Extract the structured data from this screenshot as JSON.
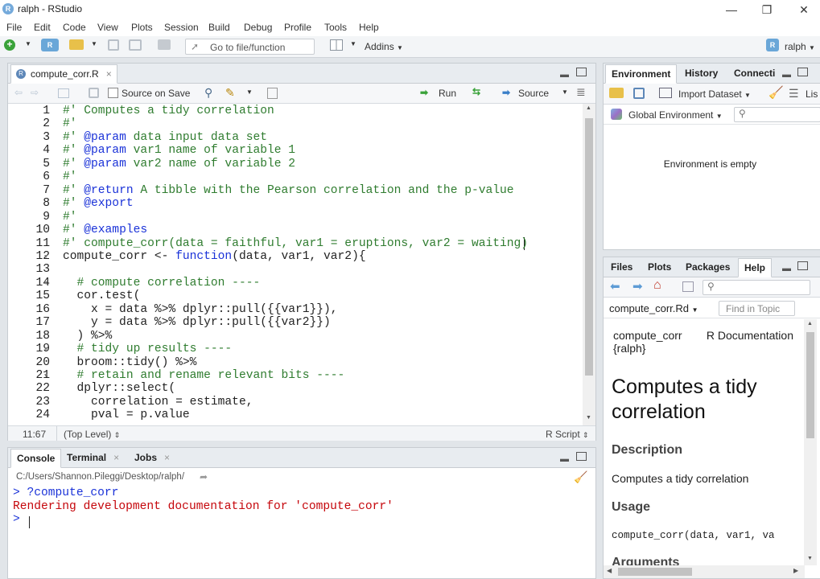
{
  "window": {
    "title": "ralph - RStudio",
    "minimize": "—",
    "maximize": "❐",
    "close": "✕"
  },
  "menu": [
    "File",
    "Edit",
    "Code",
    "View",
    "Plots",
    "Session",
    "Build",
    "Debug",
    "Profile",
    "Tools",
    "Help"
  ],
  "toolbar": {
    "goto_placeholder": "Go to file/function",
    "addins": "Addins",
    "project": "ralph"
  },
  "editor": {
    "tab_label": "compute_corr.R",
    "source_on_save": "Source on Save",
    "run": "Run",
    "source": "Source",
    "lines": [
      {
        "n": "1",
        "segs": [
          [
            "cmt",
            "#' Computes a tidy correlation"
          ]
        ]
      },
      {
        "n": "2",
        "segs": [
          [
            "cmt",
            "#'"
          ]
        ]
      },
      {
        "n": "3",
        "segs": [
          [
            "cmt",
            "#' "
          ],
          [
            "kw",
            "@param"
          ],
          [
            "cmt",
            " data input data set"
          ]
        ]
      },
      {
        "n": "4",
        "segs": [
          [
            "cmt",
            "#' "
          ],
          [
            "kw",
            "@param"
          ],
          [
            "cmt",
            " var1 name of variable 1"
          ]
        ]
      },
      {
        "n": "5",
        "segs": [
          [
            "cmt",
            "#' "
          ],
          [
            "kw",
            "@param"
          ],
          [
            "cmt",
            " var2 name of variable 2"
          ]
        ]
      },
      {
        "n": "6",
        "segs": [
          [
            "cmt",
            "#'"
          ]
        ]
      },
      {
        "n": "7",
        "segs": [
          [
            "cmt",
            "#' "
          ],
          [
            "kw",
            "@return"
          ],
          [
            "cmt",
            " A tibble with the Pearson correlation and the p-value"
          ]
        ]
      },
      {
        "n": "8",
        "segs": [
          [
            "cmt",
            "#' "
          ],
          [
            "kw",
            "@export"
          ]
        ]
      },
      {
        "n": "9",
        "segs": [
          [
            "cmt",
            "#'"
          ]
        ]
      },
      {
        "n": "10",
        "segs": [
          [
            "cmt",
            "#' "
          ],
          [
            "kw",
            "@examples"
          ]
        ]
      },
      {
        "n": "11",
        "segs": [
          [
            "cmt",
            "#' compute_corr(data = faithful, var1 = eruptions, var2 = waiting)"
          ]
        ]
      },
      {
        "n": "12",
        "fold": true,
        "segs": [
          [
            "",
            "compute_corr <- "
          ],
          [
            "kw",
            "function"
          ],
          [
            "",
            "(data, var1, var2){"
          ]
        ]
      },
      {
        "n": "13",
        "segs": []
      },
      {
        "n": "14",
        "fold": true,
        "segs": [
          [
            "",
            "  "
          ],
          [
            "cmt",
            "# compute correlation ----"
          ]
        ]
      },
      {
        "n": "15",
        "segs": [
          [
            "",
            "  cor.test("
          ]
        ]
      },
      {
        "n": "16",
        "segs": [
          [
            "",
            "    x = data %>% dplyr::pull({{var1}}),"
          ]
        ]
      },
      {
        "n": "17",
        "segs": [
          [
            "",
            "    y = data %>% dplyr::pull({{var2}})"
          ]
        ]
      },
      {
        "n": "18",
        "segs": [
          [
            "",
            "  ) %>%"
          ]
        ]
      },
      {
        "n": "19",
        "fold": true,
        "segs": [
          [
            "",
            "  "
          ],
          [
            "cmt",
            "# tidy up results ----"
          ]
        ]
      },
      {
        "n": "20",
        "segs": [
          [
            "",
            "  broom::tidy() %>%"
          ]
        ]
      },
      {
        "n": "21",
        "fold": true,
        "segs": [
          [
            "",
            "  "
          ],
          [
            "cmt",
            "# retain and rename relevant bits ----"
          ]
        ]
      },
      {
        "n": "22",
        "segs": [
          [
            "",
            "  dplyr::select("
          ]
        ]
      },
      {
        "n": "23",
        "segs": [
          [
            "",
            "    correlation = estimate,"
          ]
        ]
      },
      {
        "n": "24",
        "segs": [
          [
            "",
            "    pval = p.value"
          ]
        ]
      }
    ],
    "status": {
      "position": "11:67",
      "scope": "(Top Level)",
      "filetype": "R Script"
    }
  },
  "console": {
    "tabs": [
      "Console",
      "Terminal",
      "Jobs"
    ],
    "path": "C:/Users/Shannon.Pileggi/Desktop/ralph/",
    "lines": [
      {
        "cls": "cmd",
        "text": "> ?compute_corr"
      },
      {
        "cls": "err",
        "text": "Rendering development documentation for 'compute_corr'"
      },
      {
        "cls": "cmd",
        "text": ">"
      }
    ]
  },
  "environment": {
    "tabs": [
      "Environment",
      "History",
      "Connecti"
    ],
    "import_dataset": "Import Dataset",
    "list_label": "Lis",
    "scope": "Global Environment",
    "empty_message": "Environment is empty"
  },
  "help": {
    "tabs": [
      "Files",
      "Plots",
      "Packages",
      "Help"
    ],
    "topic": "compute_corr.Rd",
    "find_placeholder": "Find in Topic",
    "header_left": "compute_corr {ralph}",
    "header_right": "R Documentation",
    "title": "Computes a tidy correlation",
    "description_heading": "Description",
    "description": "Computes a tidy correlation",
    "usage_heading": "Usage",
    "usage": "compute_corr(data, var1, va",
    "arguments_heading": "Arguments"
  },
  "colors": {
    "accent": "#75aadb",
    "comment": "#2f7c2f",
    "keyword": "#1a32d8",
    "error": "#c5060b"
  }
}
